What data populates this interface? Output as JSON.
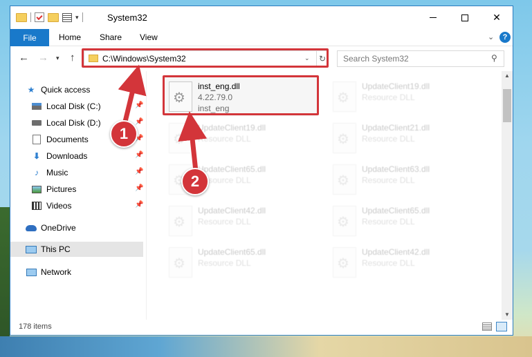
{
  "window": {
    "title": "System32"
  },
  "ribbon": {
    "file_tab": "File",
    "home_tab": "Home",
    "share_tab": "Share",
    "view_tab": "View"
  },
  "address": {
    "path": "C:\\Windows\\System32",
    "search_placeholder": "Search System32"
  },
  "nav": {
    "items": [
      {
        "label": "Quick access",
        "icon": "star-icon"
      },
      {
        "label": "Local Disk (C:)",
        "icon": "disk-icon",
        "pinned": true
      },
      {
        "label": "Local Disk (D:)",
        "icon": "disk-icon",
        "pinned": true
      },
      {
        "label": "Documents",
        "icon": "document-icon",
        "pinned": true
      },
      {
        "label": "Downloads",
        "icon": "download-icon",
        "pinned": true
      },
      {
        "label": "Music",
        "icon": "music-icon",
        "pinned": true
      },
      {
        "label": "Pictures",
        "icon": "picture-icon",
        "pinned": true
      },
      {
        "label": "Videos",
        "icon": "video-icon",
        "pinned": true
      },
      {
        "label": "OneDrive",
        "icon": "cloud-icon"
      },
      {
        "label": "This PC",
        "icon": "computer-icon",
        "selected": true
      },
      {
        "label": "Network",
        "icon": "network-icon"
      }
    ]
  },
  "files": {
    "main": {
      "name": "inst_eng.dll",
      "version": "4.22.79.0",
      "description": "inst_eng"
    },
    "faded": [
      {
        "name": "UpdateClient19.dll",
        "type": "Resource DLL"
      },
      {
        "name": "UpdateClient19.dll",
        "type": "Resource DLL"
      },
      {
        "name": "UpdateClient21.dll",
        "type": "Resource DLL"
      },
      {
        "name": "UpdateClient65.dll",
        "type": "Resource DLL"
      },
      {
        "name": "UpdateClient63.dll",
        "type": "Resource DLL"
      },
      {
        "name": "UpdateClient42.dll",
        "type": "Resource DLL"
      },
      {
        "name": "UpdateClient65.dll",
        "type": "Resource DLL"
      },
      {
        "name": "UpdateClient65.dll",
        "type": "Resource DLL"
      },
      {
        "name": "UpdateClient42.dll",
        "type": "Resource DLL"
      }
    ]
  },
  "status": {
    "item_count": "178 items"
  },
  "annotations": {
    "step1": "1",
    "step2": "2",
    "highlight_color": "#d3353a"
  }
}
